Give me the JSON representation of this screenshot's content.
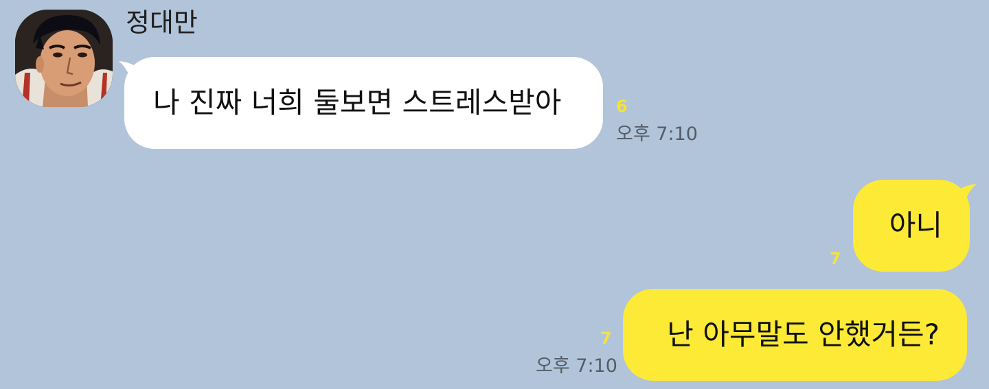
{
  "incoming": {
    "sender": "정대만",
    "avatar_icon": "profile-avatar-icon",
    "message": "나 진짜 너희 둘보면 스트레스받아",
    "unread": "6",
    "time": "오후 7:10"
  },
  "outgoing": [
    {
      "message": "아니",
      "unread": "7",
      "time": ""
    },
    {
      "message": "난 아무말도 안했거든?",
      "unread": "7",
      "time": "오후 7:10"
    }
  ],
  "colors": {
    "background": "#b1c4da",
    "incoming_bubble": "#ffffff",
    "outgoing_bubble": "#fdea36",
    "unread": "#f5e23a",
    "time": "#555c66"
  }
}
